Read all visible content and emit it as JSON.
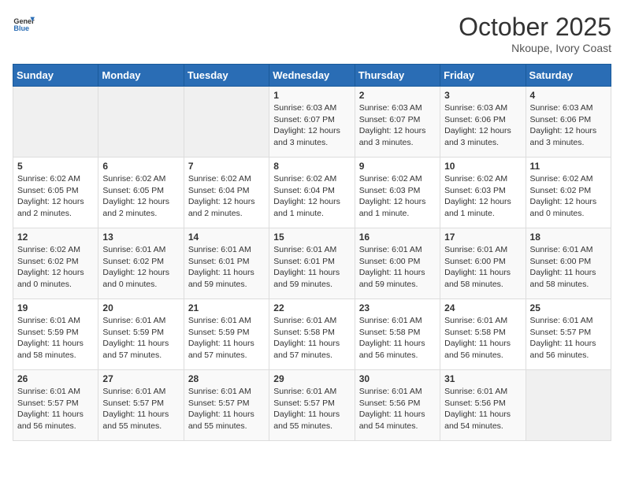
{
  "logo": {
    "line1": "General",
    "line2": "Blue"
  },
  "title": "October 2025",
  "location": "Nkoupe, Ivory Coast",
  "weekdays": [
    "Sunday",
    "Monday",
    "Tuesday",
    "Wednesday",
    "Thursday",
    "Friday",
    "Saturday"
  ],
  "rows": [
    [
      {
        "day": "",
        "info": ""
      },
      {
        "day": "",
        "info": ""
      },
      {
        "day": "",
        "info": ""
      },
      {
        "day": "1",
        "info": "Sunrise: 6:03 AM\nSunset: 6:07 PM\nDaylight: 12 hours\nand 3 minutes."
      },
      {
        "day": "2",
        "info": "Sunrise: 6:03 AM\nSunset: 6:07 PM\nDaylight: 12 hours\nand 3 minutes."
      },
      {
        "day": "3",
        "info": "Sunrise: 6:03 AM\nSunset: 6:06 PM\nDaylight: 12 hours\nand 3 minutes."
      },
      {
        "day": "4",
        "info": "Sunrise: 6:03 AM\nSunset: 6:06 PM\nDaylight: 12 hours\nand 3 minutes."
      }
    ],
    [
      {
        "day": "5",
        "info": "Sunrise: 6:02 AM\nSunset: 6:05 PM\nDaylight: 12 hours\nand 2 minutes."
      },
      {
        "day": "6",
        "info": "Sunrise: 6:02 AM\nSunset: 6:05 PM\nDaylight: 12 hours\nand 2 minutes."
      },
      {
        "day": "7",
        "info": "Sunrise: 6:02 AM\nSunset: 6:04 PM\nDaylight: 12 hours\nand 2 minutes."
      },
      {
        "day": "8",
        "info": "Sunrise: 6:02 AM\nSunset: 6:04 PM\nDaylight: 12 hours\nand 1 minute."
      },
      {
        "day": "9",
        "info": "Sunrise: 6:02 AM\nSunset: 6:03 PM\nDaylight: 12 hours\nand 1 minute."
      },
      {
        "day": "10",
        "info": "Sunrise: 6:02 AM\nSunset: 6:03 PM\nDaylight: 12 hours\nand 1 minute."
      },
      {
        "day": "11",
        "info": "Sunrise: 6:02 AM\nSunset: 6:02 PM\nDaylight: 12 hours\nand 0 minutes."
      }
    ],
    [
      {
        "day": "12",
        "info": "Sunrise: 6:02 AM\nSunset: 6:02 PM\nDaylight: 12 hours\nand 0 minutes."
      },
      {
        "day": "13",
        "info": "Sunrise: 6:01 AM\nSunset: 6:02 PM\nDaylight: 12 hours\nand 0 minutes."
      },
      {
        "day": "14",
        "info": "Sunrise: 6:01 AM\nSunset: 6:01 PM\nDaylight: 11 hours\nand 59 minutes."
      },
      {
        "day": "15",
        "info": "Sunrise: 6:01 AM\nSunset: 6:01 PM\nDaylight: 11 hours\nand 59 minutes."
      },
      {
        "day": "16",
        "info": "Sunrise: 6:01 AM\nSunset: 6:00 PM\nDaylight: 11 hours\nand 59 minutes."
      },
      {
        "day": "17",
        "info": "Sunrise: 6:01 AM\nSunset: 6:00 PM\nDaylight: 11 hours\nand 58 minutes."
      },
      {
        "day": "18",
        "info": "Sunrise: 6:01 AM\nSunset: 6:00 PM\nDaylight: 11 hours\nand 58 minutes."
      }
    ],
    [
      {
        "day": "19",
        "info": "Sunrise: 6:01 AM\nSunset: 5:59 PM\nDaylight: 11 hours\nand 58 minutes."
      },
      {
        "day": "20",
        "info": "Sunrise: 6:01 AM\nSunset: 5:59 PM\nDaylight: 11 hours\nand 57 minutes."
      },
      {
        "day": "21",
        "info": "Sunrise: 6:01 AM\nSunset: 5:59 PM\nDaylight: 11 hours\nand 57 minutes."
      },
      {
        "day": "22",
        "info": "Sunrise: 6:01 AM\nSunset: 5:58 PM\nDaylight: 11 hours\nand 57 minutes."
      },
      {
        "day": "23",
        "info": "Sunrise: 6:01 AM\nSunset: 5:58 PM\nDaylight: 11 hours\nand 56 minutes."
      },
      {
        "day": "24",
        "info": "Sunrise: 6:01 AM\nSunset: 5:58 PM\nDaylight: 11 hours\nand 56 minutes."
      },
      {
        "day": "25",
        "info": "Sunrise: 6:01 AM\nSunset: 5:57 PM\nDaylight: 11 hours\nand 56 minutes."
      }
    ],
    [
      {
        "day": "26",
        "info": "Sunrise: 6:01 AM\nSunset: 5:57 PM\nDaylight: 11 hours\nand 56 minutes."
      },
      {
        "day": "27",
        "info": "Sunrise: 6:01 AM\nSunset: 5:57 PM\nDaylight: 11 hours\nand 55 minutes."
      },
      {
        "day": "28",
        "info": "Sunrise: 6:01 AM\nSunset: 5:57 PM\nDaylight: 11 hours\nand 55 minutes."
      },
      {
        "day": "29",
        "info": "Sunrise: 6:01 AM\nSunset: 5:57 PM\nDaylight: 11 hours\nand 55 minutes."
      },
      {
        "day": "30",
        "info": "Sunrise: 6:01 AM\nSunset: 5:56 PM\nDaylight: 11 hours\nand 54 minutes."
      },
      {
        "day": "31",
        "info": "Sunrise: 6:01 AM\nSunset: 5:56 PM\nDaylight: 11 hours\nand 54 minutes."
      },
      {
        "day": "",
        "info": ""
      }
    ]
  ]
}
